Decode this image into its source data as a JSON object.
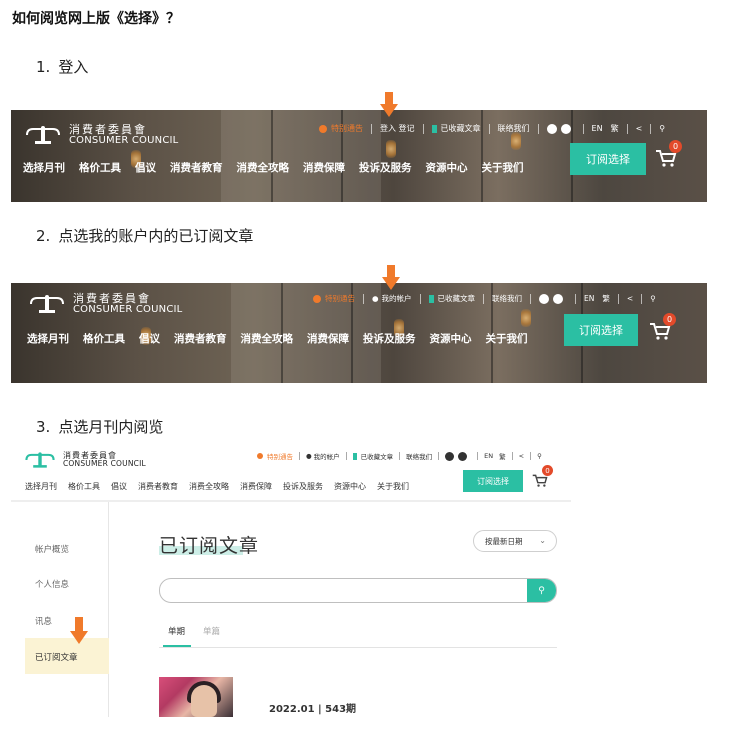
{
  "heading": "如何阅览网上版《选择》？",
  "steps": [
    {
      "num": "1.",
      "text": "登入"
    },
    {
      "num": "2.",
      "text": "点选我的账户内的已订阅文章"
    },
    {
      "num": "3.",
      "text": "点选月刊内阅览"
    }
  ],
  "site": {
    "logo_zh": "消費者委員會",
    "logo_en": "CONSUMER COUNCIL",
    "alert": "特别通告",
    "login": "登入 登记",
    "my_account": "我的帐户",
    "saved": "已收藏文章",
    "contact": "联络我们",
    "lang_en": "EN",
    "lang_tc": "繁",
    "nav": [
      "选择月刊",
      "格价工具",
      "倡议",
      "消费者教育",
      "消费全攻略",
      "消费保障",
      "投诉及服务",
      "资源中心",
      "关于我们"
    ],
    "subscribe": "订阅选择",
    "cart_count": "0"
  },
  "account_page": {
    "side_items": [
      "帐户概览",
      "个人信息",
      "讯息",
      "已订阅文章"
    ],
    "title": "已订阅文章",
    "sort": "按最新日期",
    "tabs": [
      "单期",
      "单篇"
    ],
    "issue": "2022.01 | 543期"
  },
  "colors": {
    "accent": "#2bbfa3",
    "arrow": "#f07a2b",
    "badge": "#e34a2a",
    "highlight": "#fbf3d4"
  }
}
